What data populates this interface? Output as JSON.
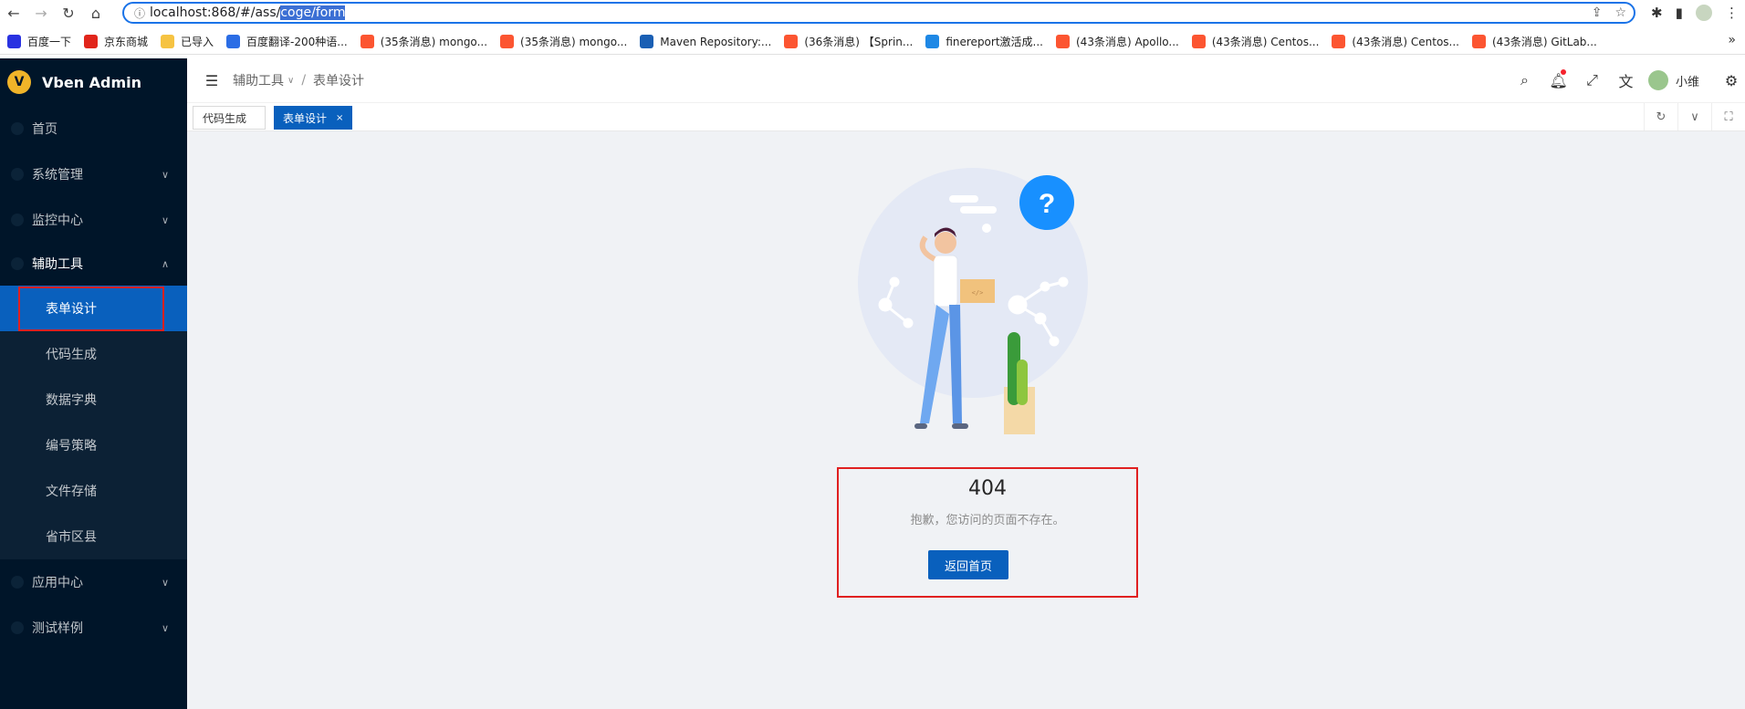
{
  "browser": {
    "url_plain": "localhost:868/#/ass/",
    "url_selected": "coge/form",
    "bookmarks": [
      {
        "label": "百度一下",
        "color": "#2932e1"
      },
      {
        "label": "京东商城",
        "color": "#e1251b"
      },
      {
        "label": "已导入",
        "color": "#f6c342"
      },
      {
        "label": "百度翻译-200种语...",
        "color": "#2b6de5"
      },
      {
        "label": "(35条消息) mongo...",
        "color": "#fc5531"
      },
      {
        "label": "(35条消息) mongo...",
        "color": "#fc5531"
      },
      {
        "label": "Maven Repository:...",
        "color": "#1a5fb4"
      },
      {
        "label": "(36条消息) 【Sprin...",
        "color": "#fc5531"
      },
      {
        "label": "finereport激活成...",
        "color": "#1e88e5"
      },
      {
        "label": "(43条消息) Apollo...",
        "color": "#fc5531"
      },
      {
        "label": "(43条消息) Centos...",
        "color": "#fc5531"
      },
      {
        "label": "(43条消息) Centos...",
        "color": "#fc5531"
      },
      {
        "label": "(43条消息) GitLab...",
        "color": "#fc5531"
      }
    ]
  },
  "app": {
    "title": "Vben Admin"
  },
  "sidebar": {
    "items": [
      {
        "label": "首页"
      },
      {
        "label": "系统管理"
      },
      {
        "label": "监控中心"
      },
      {
        "label": "辅助工具"
      },
      {
        "label": "表单设计"
      },
      {
        "label": "代码生成"
      },
      {
        "label": "数据字典"
      },
      {
        "label": "编号策略"
      },
      {
        "label": "文件存储"
      },
      {
        "label": "省市区县"
      },
      {
        "label": "应用中心"
      },
      {
        "label": "测试样例"
      }
    ]
  },
  "header": {
    "breadcrumb_parent": "辅助工具",
    "breadcrumb_current": "表单设计",
    "username": "小维"
  },
  "tabs": [
    {
      "label": "代码生成"
    },
    {
      "label": "表单设计"
    }
  ],
  "result": {
    "status": "404",
    "message": "抱歉，您访问的页面不存在。",
    "button": "返回首页"
  },
  "colors": {
    "primary": "#0960bd",
    "sidebar_bg": "#001529",
    "highlight": "#e02020"
  }
}
